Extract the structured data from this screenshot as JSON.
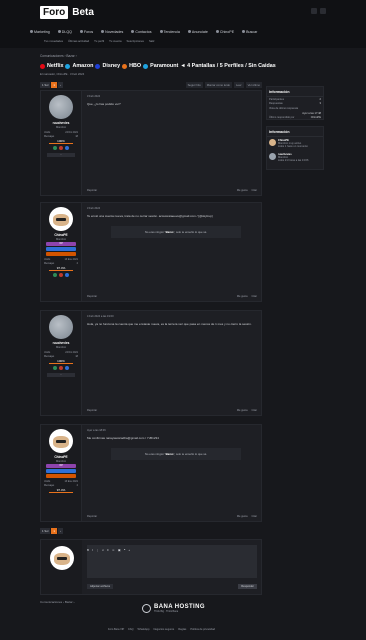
{
  "header": {
    "logo_foro": "Foro",
    "logo_beta": "Beta"
  },
  "nav": {
    "items": [
      "Marketing",
      "DLQQ",
      "Foros",
      "Novedades",
      "Contactos",
      "Tendencia",
      "Anunciate",
      "ChinoPE",
      "Buscar"
    ],
    "sub": [
      "Tus novedades",
      "Últimas actividad",
      "Tu perfil",
      "Tu cuenta",
      "Suscripciones",
      "Salir"
    ]
  },
  "breadcrumb": "Comunicaciones  ›  Bazar  ›",
  "thread": {
    "title_items": [
      {
        "label": "Netflix",
        "color": "#e50914"
      },
      {
        "label": "Amazon",
        "color": "#1fa3e0"
      },
      {
        "label": "Disney",
        "color": "#1f3fd6"
      },
      {
        "label": "HBO",
        "color": "#e8721c"
      },
      {
        "label": "Paramount",
        "color": "#1fa3e0"
      }
    ],
    "title_rest": "◄ 4 Pantallas / 5 Perfiles / Sin Caidas",
    "meta": "El marcador, ChinoPE · 3 Feb 2024"
  },
  "pagination": {
    "label": "1 Sol",
    "page": "1",
    "next": "›"
  },
  "tools": [
    "Seguir hilo",
    "Marcar como leído",
    "Leer",
    "Ver último"
  ],
  "posts": [
    {
      "user": "ruuchevies",
      "role": "Miembro",
      "badge": "",
      "stats": [
        [
          "Unido",
          "24 Dic 2021"
        ],
        [
          "Mensajes",
          "18"
        ]
      ],
      "pct": "100%",
      "date": "3 Feb 2024",
      "text": "Que, ¿lo has podido ver?",
      "quote": "",
      "foot_left": "Reportar",
      "foot_like": "Me gusta",
      "foot_reply": "Citar"
    },
    {
      "user": "ChinoPE",
      "role": "Miembro",
      "badge": "VIP",
      "stats": [
        [
          "Unido",
          "13 Ene 2021"
        ],
        [
          "Mensajes",
          "2"
        ]
      ],
      "pct": "97.4%",
      "date": "3 Feb 2024",
      "text": "Te envió una cuenta nueva, trata de no cerrar sesión. acceswsiaeeve@gmail.com / [@skylrep]",
      "quote_pre": "No eres ningún \"",
      "quote_bold": "Bamo",
      "quote_post": "\", solo te enseño lo que sé.",
      "foot_left": "Reportar",
      "foot_like": "Me gusta",
      "foot_reply": "Citar"
    },
    {
      "user": "ruuchevies",
      "role": "Miembro",
      "badge": "",
      "stats": [
        [
          "Unido",
          "24 Dic 2021"
        ],
        [
          "Mensajes",
          "18"
        ]
      ],
      "pct": "100%",
      "date": "4 Feb 2024 a las 19:00",
      "text": "Hola, ya no funciona la cuenta que me enviaste nueva, es la tercera vez que pasa en menos de 1 mes y no cierro la sesión.",
      "quote": "",
      "foot_left": "Reportar",
      "foot_like": "Me gusta",
      "foot_reply": "Citar"
    },
    {
      "user": "ChinoPE",
      "role": "Miembro",
      "badge": "VIP",
      "stats": [
        [
          "Unido",
          "13 Ene 2021"
        ],
        [
          "Mensajes",
          "2"
        ]
      ],
      "pct": "97.4%",
      "date": "Ayer a las 18:06",
      "text": "Me confirmas naraywestcadha@gmail.com / Yd51234",
      "quote_pre": "No eres ningún \"",
      "quote_bold": "Bamo",
      "quote_post": "\", solo te enseño lo que sé.",
      "foot_left": "Reportar",
      "foot_like": "Me gusta",
      "foot_reply": "Citar"
    }
  ],
  "sidebar": {
    "info_title": "Información",
    "info_rows": [
      [
        "Participantes",
        "2"
      ],
      [
        "Respuestas",
        "3"
      ],
      [
        "Vista de último respuesta",
        ""
      ],
      [
        "",
        "Ayer a las 17:48"
      ],
      [
        "Último respondido por",
        "ChinoPE"
      ]
    ],
    "members_title": "Información",
    "members": [
      {
        "name": "ChinoPE",
        "lines": [
          "Miembro muy activo",
          "Lidos 1 hace un momento"
        ]
      },
      {
        "name": "ruuchevies",
        "lines": [
          "Miembro",
          "Lidos 21 horas a las 13:06"
        ]
      }
    ]
  },
  "editor": {
    "attach": "Adjuntar archivos",
    "reply": "Responder"
  },
  "footer_bc": "Comunicaciones  ›  Bazar  ›",
  "sponsor": {
    "name": "BANA HOSTING",
    "tag": "Think Big · Think Bana"
  },
  "footer_links": [
    "Foro Beta VIP",
    "FAQ",
    "WhatsApp",
    "Negocios seguros",
    "Reglas",
    "Política de privacidad"
  ]
}
